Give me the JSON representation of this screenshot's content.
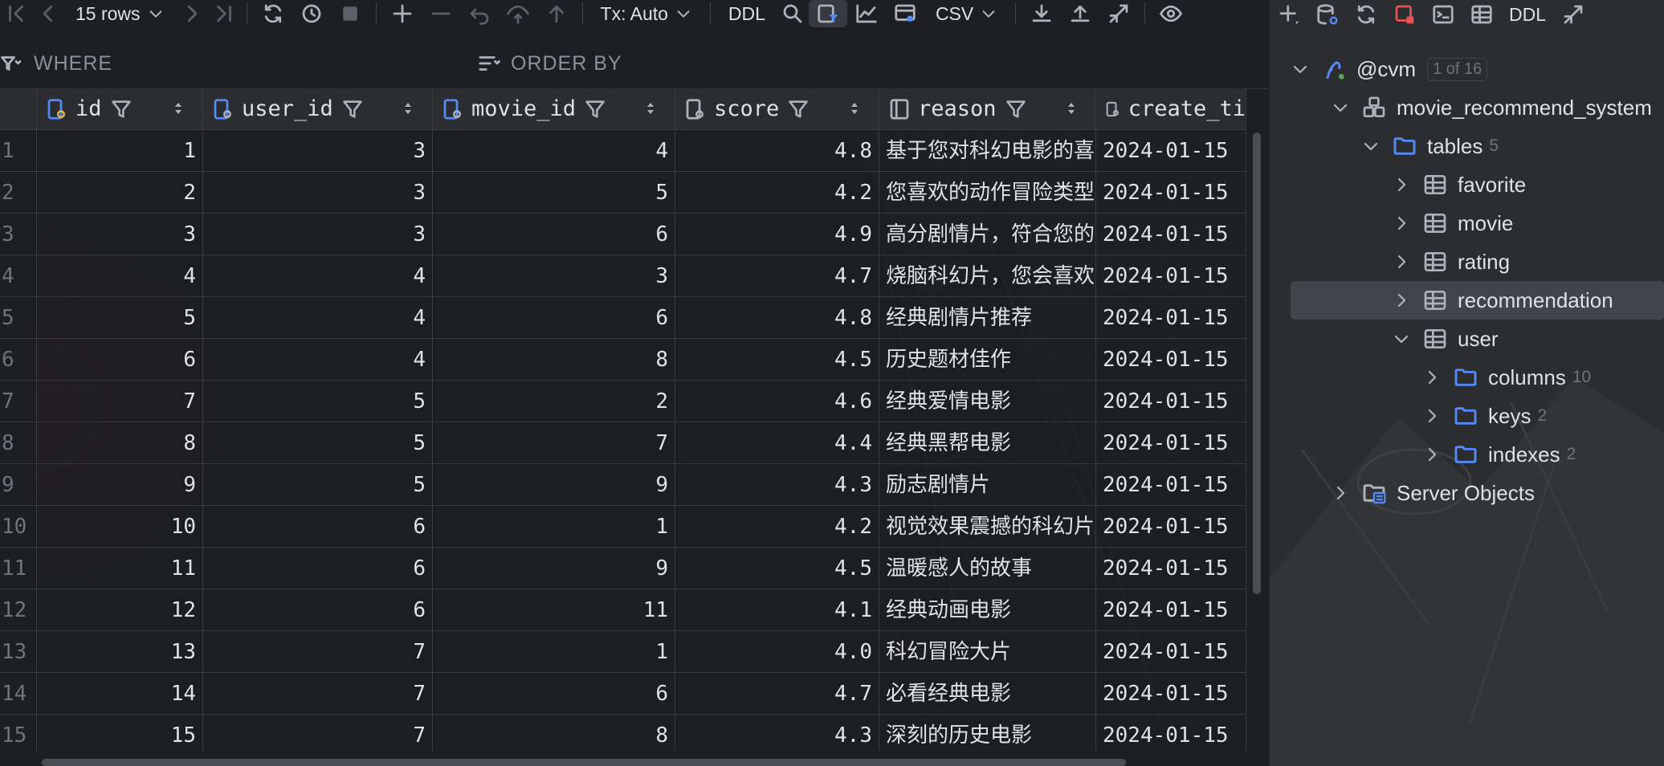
{
  "toolbar": {
    "rows_label": "15 rows",
    "tx_label": "Tx: Auto",
    "ddl_label": "DDL",
    "format_label": "CSV"
  },
  "filter": {
    "where_label": "WHERE",
    "order_label": "ORDER BY"
  },
  "columns": [
    {
      "name": "id",
      "type": "key"
    },
    {
      "name": "user_id",
      "type": "fk"
    },
    {
      "name": "movie_id",
      "type": "fk"
    },
    {
      "name": "score",
      "type": "col"
    },
    {
      "name": "reason",
      "type": "col"
    },
    {
      "name": "create_ti",
      "type": "col"
    }
  ],
  "rows": [
    {
      "rn": "1",
      "id": "1",
      "user_id": "3",
      "movie_id": "4",
      "score": "4.8",
      "reason": "基于您对科幻电影的喜",
      "create": "2024-01-15"
    },
    {
      "rn": "2",
      "id": "2",
      "user_id": "3",
      "movie_id": "5",
      "score": "4.2",
      "reason": "您喜欢的动作冒险类型",
      "create": "2024-01-15"
    },
    {
      "rn": "3",
      "id": "3",
      "user_id": "3",
      "movie_id": "6",
      "score": "4.9",
      "reason": "高分剧情片，符合您的",
      "create": "2024-01-15"
    },
    {
      "rn": "4",
      "id": "4",
      "user_id": "4",
      "movie_id": "3",
      "score": "4.7",
      "reason": "烧脑科幻片，您会喜欢",
      "create": "2024-01-15"
    },
    {
      "rn": "5",
      "id": "5",
      "user_id": "4",
      "movie_id": "6",
      "score": "4.8",
      "reason": "经典剧情片推荐",
      "create": "2024-01-15"
    },
    {
      "rn": "6",
      "id": "6",
      "user_id": "4",
      "movie_id": "8",
      "score": "4.5",
      "reason": "历史题材佳作",
      "create": "2024-01-15"
    },
    {
      "rn": "7",
      "id": "7",
      "user_id": "5",
      "movie_id": "2",
      "score": "4.6",
      "reason": "经典爱情电影",
      "create": "2024-01-15"
    },
    {
      "rn": "8",
      "id": "8",
      "user_id": "5",
      "movie_id": "7",
      "score": "4.4",
      "reason": "经典黑帮电影",
      "create": "2024-01-15"
    },
    {
      "rn": "9",
      "id": "9",
      "user_id": "5",
      "movie_id": "9",
      "score": "4.3",
      "reason": "励志剧情片",
      "create": "2024-01-15"
    },
    {
      "rn": "10",
      "id": "10",
      "user_id": "6",
      "movie_id": "1",
      "score": "4.2",
      "reason": "视觉效果震撼的科幻片",
      "create": "2024-01-15"
    },
    {
      "rn": "11",
      "id": "11",
      "user_id": "6",
      "movie_id": "9",
      "score": "4.5",
      "reason": "温暖感人的故事",
      "create": "2024-01-15"
    },
    {
      "rn": "12",
      "id": "12",
      "user_id": "6",
      "movie_id": "11",
      "score": "4.1",
      "reason": "经典动画电影",
      "create": "2024-01-15"
    },
    {
      "rn": "13",
      "id": "13",
      "user_id": "7",
      "movie_id": "1",
      "score": "4.0",
      "reason": "科幻冒险大片",
      "create": "2024-01-15"
    },
    {
      "rn": "14",
      "id": "14",
      "user_id": "7",
      "movie_id": "6",
      "score": "4.7",
      "reason": "必看经典电影",
      "create": "2024-01-15"
    },
    {
      "rn": "15",
      "id": "15",
      "user_id": "7",
      "movie_id": "8",
      "score": "4.3",
      "reason": "深刻的历史电影",
      "create": "2024-01-15"
    }
  ],
  "panel": {
    "ddl_label": "DDL",
    "tree": [
      {
        "label": "@cvm",
        "badge": "1 of 16",
        "icon": "postgres-icon",
        "expanded": true
      },
      {
        "label": "movie_recommend_system",
        "icon": "schema-icon",
        "expanded": true
      },
      {
        "label": "tables",
        "count": "5",
        "icon": "folder-icon",
        "expanded": true
      },
      {
        "label": "favorite",
        "icon": "table-icon",
        "expanded": false
      },
      {
        "label": "movie",
        "icon": "table-icon",
        "expanded": false
      },
      {
        "label": "rating",
        "icon": "table-icon",
        "expanded": false
      },
      {
        "label": "recommendation",
        "icon": "table-icon",
        "expanded": false,
        "selected": true
      },
      {
        "label": "user",
        "icon": "table-icon",
        "expanded": true
      },
      {
        "label": "columns",
        "count": "10",
        "icon": "folder-icon",
        "expanded": false
      },
      {
        "label": "keys",
        "count": "2",
        "icon": "folder-icon",
        "expanded": false
      },
      {
        "label": "indexes",
        "count": "2",
        "icon": "folder-icon",
        "expanded": false
      },
      {
        "label": "Server Objects",
        "icon": "server-objects-icon",
        "expanded": false
      }
    ]
  },
  "colors": {
    "background": "#1e1f22",
    "grid_line": "#393b40",
    "header_bg": "#2b2d30",
    "accent_blue": "#548af7",
    "stop_red": "#e55353"
  }
}
